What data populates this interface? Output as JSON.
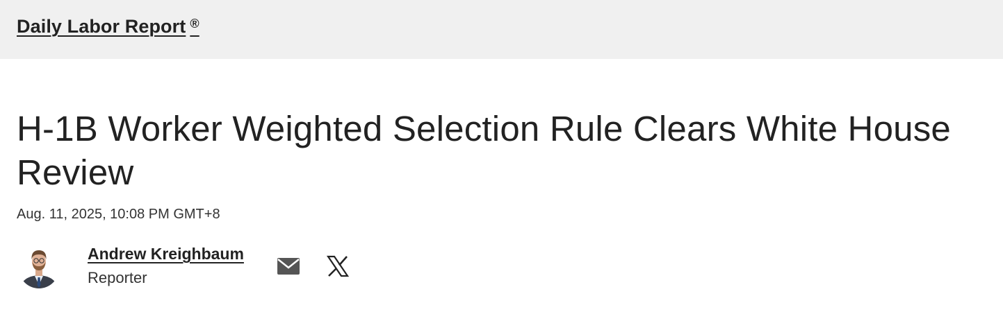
{
  "header": {
    "section_label": "Daily Labor Report",
    "registered_mark": "®"
  },
  "article": {
    "headline": "H-1B Worker Weighted Selection Rule Clears White House Review",
    "dateline": "Aug. 11, 2025, 10:08 PM GMT+8"
  },
  "author": {
    "name": "Andrew Kreighbaum",
    "role": "Reporter",
    "avatar_icon": "author-photo",
    "share_icons": [
      "envelope-icon",
      "x-logo-icon"
    ]
  },
  "colors": {
    "header_bg": "#f0f0f0",
    "text": "#222222",
    "icon_gray": "#555555"
  }
}
